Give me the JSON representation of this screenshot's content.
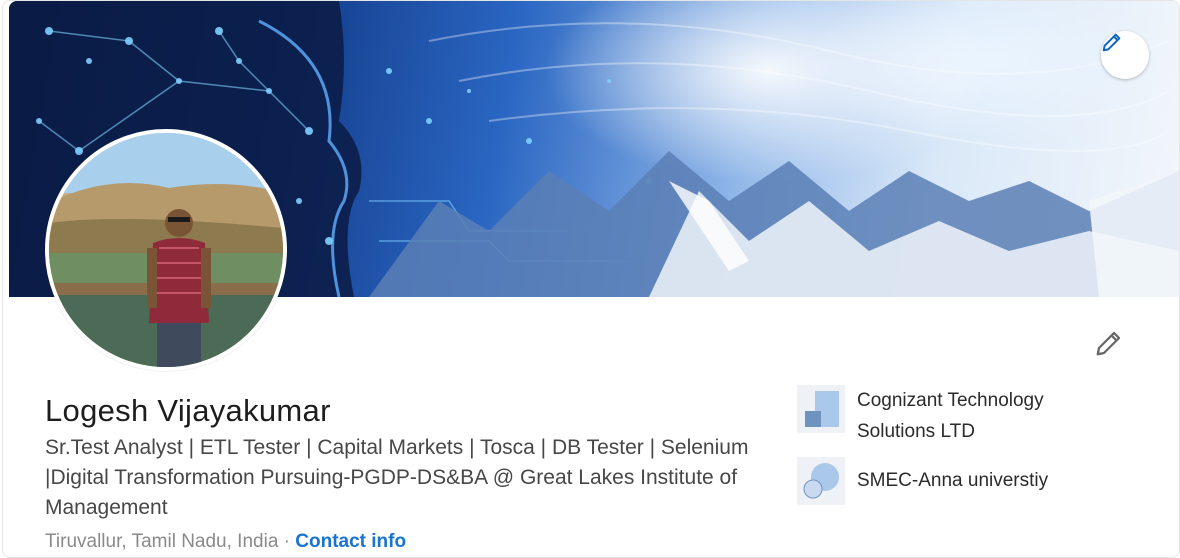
{
  "profile": {
    "name": "Logesh Vijayakumar",
    "headline": "Sr.Test Analyst | ETL Tester | Capital Markets | Tosca | DB Tester | Selenium |Digital Transformation Pursuing-PGDP-DS&BA @ Great Lakes Institute of Management",
    "location": "Tiruvallur, Tamil Nadu, India",
    "separator": "·",
    "contact_label": "Contact info"
  },
  "organizations": [
    {
      "name": "Cognizant Technology Solutions LTD",
      "icon": "company-logo-icon"
    },
    {
      "name": "SMEC-Anna universtiy",
      "icon": "school-logo-icon"
    }
  ],
  "actions": {
    "edit_banner_icon": "pencil-icon",
    "edit_profile_icon": "pencil-icon"
  },
  "colors": {
    "link": "#1a73d1",
    "edit_banner_icon": "#0a66c2",
    "text_primary": "#1d1d1d",
    "text_secondary": "#474747",
    "text_muted": "#8a8a8a"
  }
}
